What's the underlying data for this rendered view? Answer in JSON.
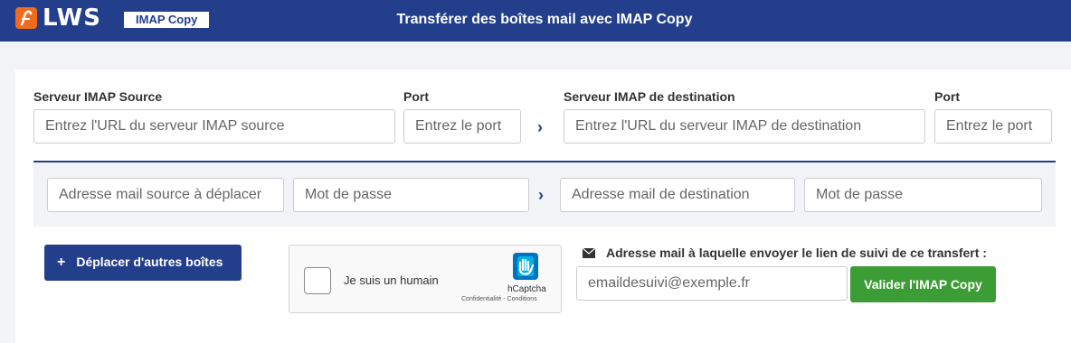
{
  "header": {
    "logo_text": "LWS",
    "badge": "IMAP Copy",
    "title": "Transférer des boîtes mail avec IMAP Copy"
  },
  "servers": {
    "source_label": "Serveur IMAP Source",
    "source_placeholder": "Entrez l'URL du serveur IMAP source",
    "source_port_label": "Port",
    "source_port_placeholder": "Entrez le port",
    "dest_label": "Serveur IMAP de destination",
    "dest_placeholder": "Entrez l'URL du serveur IMAP de destination",
    "dest_port_label": "Port",
    "dest_port_placeholder": "Entrez le port",
    "arrow": "›"
  },
  "mailbox": {
    "source_email_placeholder": "Adresse mail source à déplacer",
    "source_password_placeholder": "Mot de passe",
    "dest_email_placeholder": "Adresse mail de destination",
    "dest_password_placeholder": "Mot de passe",
    "arrow": "›"
  },
  "actions": {
    "more_plus": "+",
    "more_label": "Déplacer d'autres boîtes",
    "validate_label": "Valider l'IMAP Copy"
  },
  "captcha": {
    "label": "Je suis un humain",
    "brand": "hCaptcha",
    "links": "Confidentialité - Conditions"
  },
  "follow": {
    "label": "Adresse mail à laquelle envoyer le lien de suivi de ce transfert :",
    "placeholder": "emaildesuivi@exemple.fr"
  },
  "colors": {
    "primary": "#233f8c",
    "brand_orange": "#f26b1d",
    "success": "#3c9c35"
  }
}
